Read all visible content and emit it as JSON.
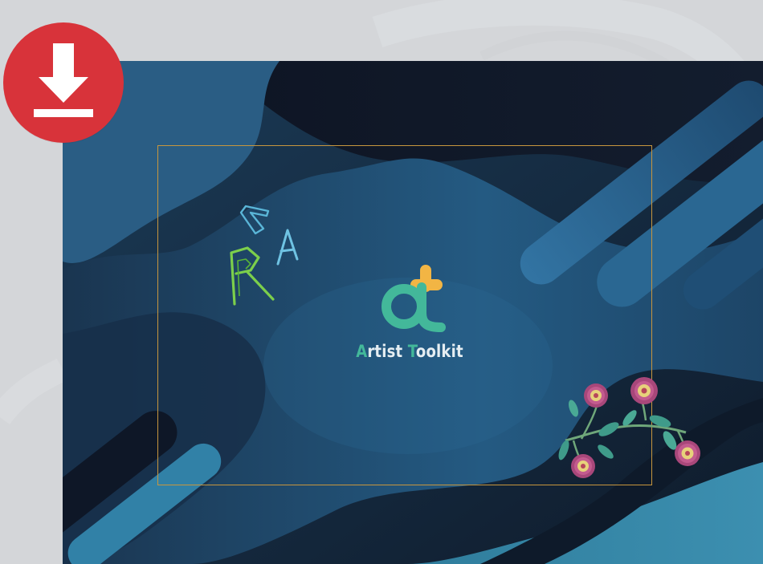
{
  "page": {
    "background": "#d4d6d9"
  },
  "download": {
    "icon": "download-icon",
    "color": "#d8333a"
  },
  "cover": {
    "frame_color": "#c7963e",
    "logo": {
      "icon": "artist-toolkit-logo-icon",
      "text_first_initial": "A",
      "text_first_rest": "rtist ",
      "text_second_initial": "T",
      "text_second_rest": "oolkit",
      "primary_color": "#43b89a",
      "accent_color": "#f2b544"
    },
    "decor_letters": [
      "C",
      "A",
      "R"
    ],
    "flowers_icon": "floral-embroidery-icon"
  }
}
